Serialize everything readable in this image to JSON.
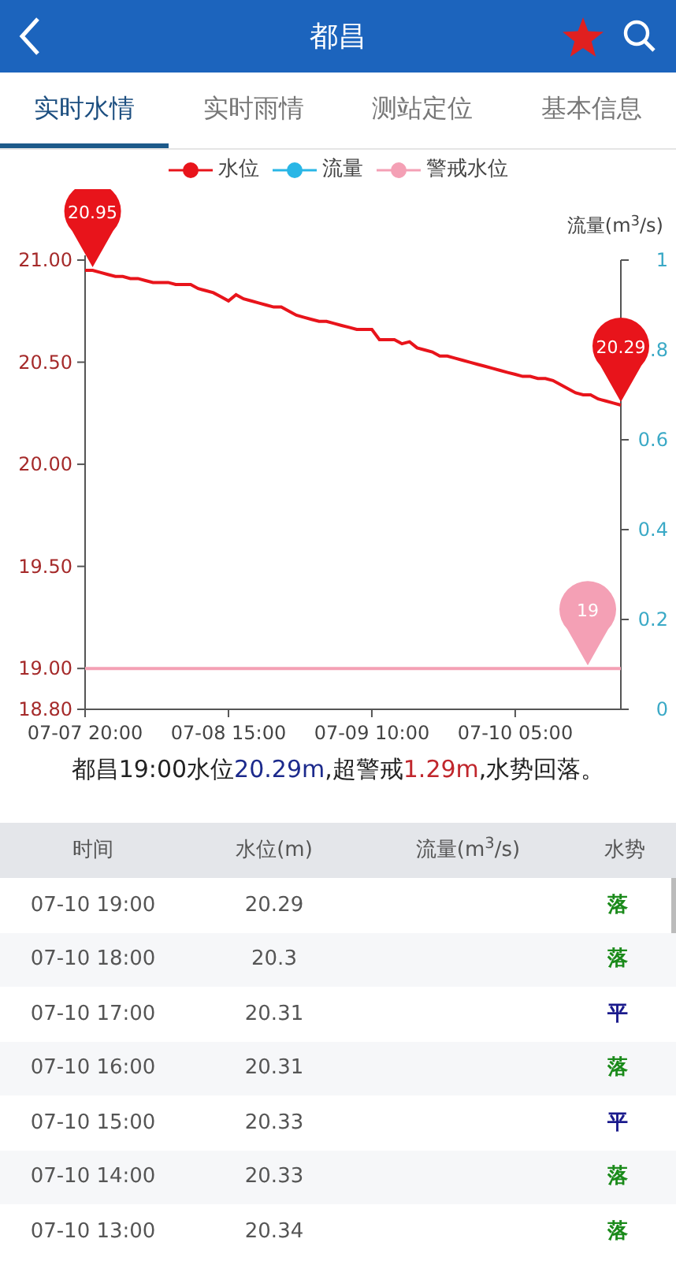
{
  "header": {
    "title": "都昌",
    "favorite": true
  },
  "tabs": [
    {
      "label": "实时水情",
      "selected": true
    },
    {
      "label": "实时雨情",
      "selected": false
    },
    {
      "label": "测站定位",
      "selected": false
    },
    {
      "label": "基本信息",
      "selected": false
    }
  ],
  "chart": {
    "chart_data": {
      "type": "line",
      "y2label": "流量(m$^{3}$/s)",
      "categories": [
        "07-07 20:00",
        null,
        null,
        null,
        null,
        null,
        null,
        null,
        null,
        null,
        null,
        null,
        null,
        null,
        null,
        null,
        null,
        null,
        null,
        "07-08 15:00",
        null,
        null,
        null,
        null,
        null,
        null,
        null,
        null,
        null,
        null,
        null,
        null,
        null,
        null,
        null,
        null,
        null,
        null,
        "07-09 10:00",
        null,
        null,
        null,
        null,
        null,
        null,
        null,
        null,
        null,
        null,
        null,
        null,
        null,
        null,
        null,
        null,
        null,
        null,
        "07-10 05:00",
        null,
        null,
        null,
        null,
        null,
        null,
        null,
        null,
        null,
        null,
        null,
        null,
        null,
        null
      ],
      "series": [
        {
          "name": "水位",
          "color": "#e8141b",
          "values": [
            20.95,
            20.95,
            20.94,
            20.93,
            20.92,
            20.92,
            20.91,
            20.91,
            20.9,
            20.89,
            20.89,
            20.89,
            20.88,
            20.88,
            20.88,
            20.86,
            20.85,
            20.84,
            20.82,
            20.8,
            20.83,
            20.81,
            20.8,
            20.79,
            20.78,
            20.77,
            20.77,
            20.75,
            20.73,
            20.72,
            20.71,
            20.7,
            20.7,
            20.69,
            20.68,
            20.67,
            20.66,
            20.66,
            20.66,
            20.61,
            20.61,
            20.61,
            20.59,
            20.6,
            20.57,
            20.56,
            20.55,
            20.53,
            20.53,
            20.52,
            20.51,
            20.5,
            20.49,
            20.48,
            20.47,
            20.46,
            20.45,
            20.44,
            20.43,
            20.43,
            20.42,
            20.42,
            20.41,
            20.39,
            20.37,
            20.35,
            20.34,
            20.34,
            20.32,
            20.31,
            20.3,
            20.29
          ]
        },
        {
          "name": "流量",
          "color": "#29b6e6",
          "values": [
            null,
            null,
            null,
            null,
            null,
            null,
            null,
            null,
            null,
            null,
            null,
            null,
            null,
            null,
            null,
            null,
            null,
            null,
            null,
            null,
            null,
            null,
            null,
            null,
            null,
            null,
            null,
            null,
            null,
            null,
            null,
            null,
            null,
            null,
            null,
            null,
            null,
            null,
            null,
            null,
            null,
            null,
            null,
            null,
            null,
            null,
            null,
            null,
            null,
            null,
            null,
            null,
            null,
            null,
            null,
            null,
            null,
            null,
            null,
            null,
            null,
            null,
            null,
            null,
            null,
            null,
            null,
            null,
            null,
            null,
            null,
            null
          ]
        },
        {
          "name": "警戒水位",
          "color": "#f4a0b5",
          "values": [
            19,
            19,
            19,
            19,
            19,
            19,
            19,
            19,
            19,
            19,
            19,
            19,
            19,
            19,
            19,
            19,
            19,
            19,
            19,
            19,
            19,
            19,
            19,
            19,
            19,
            19,
            19,
            19,
            19,
            19,
            19,
            19,
            19,
            19,
            19,
            19,
            19,
            19,
            19,
            19,
            19,
            19,
            19,
            19,
            19,
            19,
            19,
            19,
            19,
            19,
            19,
            19,
            19,
            19,
            19,
            19,
            19,
            19,
            19,
            19,
            19,
            19,
            19,
            19,
            19,
            19,
            19,
            19,
            19,
            19,
            19,
            19
          ]
        }
      ],
      "ylim": [
        18.8,
        21
      ],
      "y2lim": [
        0,
        1
      ],
      "yticks": [
        {
          "value": 18.8,
          "label": "18.80"
        },
        {
          "value": 19,
          "label": "19.00"
        },
        {
          "value": 19.5,
          "label": "19.50"
        },
        {
          "value": 20,
          "label": "20.00"
        },
        {
          "value": 20.5,
          "label": "20.50"
        },
        {
          "value": 21,
          "label": "21.00"
        }
      ],
      "y2ticks": [
        {
          "value": 0,
          "label": "0"
        },
        {
          "value": 0.2,
          "label": "0.2"
        },
        {
          "value": 0.4,
          "label": "0.4"
        },
        {
          "value": 0.6,
          "label": "0.6"
        },
        {
          "value": 0.8,
          "label": ".8"
        },
        {
          "value": 1,
          "label": "1"
        }
      ],
      "annotations": [
        {
          "text": "20.95",
          "y": 20.95
        },
        {
          "text": "20.29",
          "y": 20.29
        },
        {
          "text": "19",
          "y": 19
        }
      ]
    }
  },
  "summary": [
    {
      "text": "都昌19:00水位"
    },
    {
      "text": "20.29m",
      "color": "#1c2a8c"
    },
    {
      "text": ",超警戒"
    },
    {
      "text": "1.29m",
      "color": "#c0262c"
    },
    {
      "text": ",水势回落。"
    }
  ],
  "table": {
    "columns": [
      "时间",
      "水位(m)",
      "流量(m$^{3}$/s)",
      "水势"
    ],
    "rows": [
      {
        "time": "07-10 19:00",
        "level": "20.29",
        "trend": "落",
        "color": "#1a8a1a"
      },
      {
        "time": "07-10 18:00",
        "level": "20.3",
        "trend": "落",
        "color": "#1a8a1a"
      },
      {
        "time": "07-10 17:00",
        "level": "20.31",
        "trend": "平",
        "color": "#1a1a8c"
      },
      {
        "time": "07-10 16:00",
        "level": "20.31",
        "trend": "落",
        "color": "#1a8a1a"
      },
      {
        "time": "07-10 15:00",
        "level": "20.33",
        "trend": "平",
        "color": "#1a1a8c"
      },
      {
        "time": "07-10 14:00",
        "level": "20.33",
        "trend": "落",
        "color": "#1a8a1a"
      },
      {
        "time": "07-10 13:00",
        "level": "20.34",
        "trend": "落",
        "color": "#1a8a1a"
      }
    ]
  }
}
